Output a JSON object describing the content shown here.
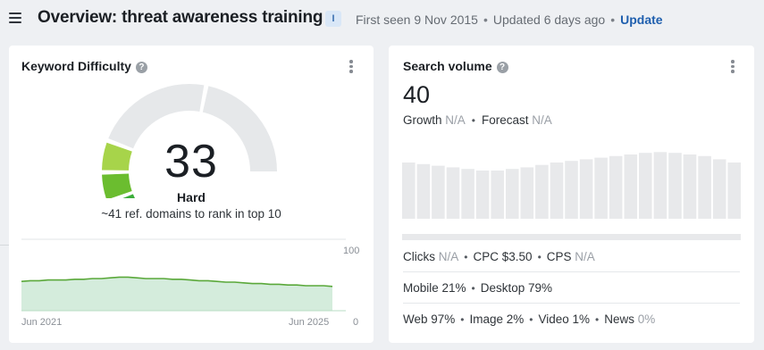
{
  "header": {
    "title": "Overview: threat awareness training",
    "info_badge": "I",
    "first_seen": "First seen 9 Nov 2015",
    "updated": "Updated 6 days ago",
    "update_link": "Update"
  },
  "keyword_difficulty": {
    "title": "Keyword Difficulty",
    "help_glyph": "?",
    "value": "33",
    "value_fraction": 0.33,
    "level": "Hard",
    "note": "~41 ref. domains to rank in top 10",
    "gauge_colors": [
      "#1fa353",
      "#3cae3b",
      "#6bbd2f",
      "#a7d44a",
      "#e6e8ea"
    ],
    "chart": {
      "type": "area",
      "y_tick_top": "100",
      "y_tick_bottom": "0",
      "x_start_label": "Jun 2021",
      "x_end_label": "Jun 2025",
      "ylim": [
        0,
        100
      ],
      "values": [
        41,
        42,
        42,
        43,
        43,
        43,
        44,
        44,
        45,
        45,
        46,
        47,
        47,
        46,
        45,
        45,
        45,
        44,
        44,
        43,
        42,
        42,
        41,
        40,
        40,
        39,
        38,
        38,
        37,
        37,
        36,
        36,
        35,
        35,
        35,
        34
      ],
      "line_color": "#5aa83a",
      "fill_color": "#d4ecdc"
    }
  },
  "search_volume": {
    "title": "Search volume",
    "help_glyph": "?",
    "value": "40",
    "growth_label": "Growth",
    "growth_value": "N/A",
    "forecast_label": "Forecast",
    "forecast_value": "N/A",
    "bar_color": "#e8e9eb",
    "bar_values": [
      0.7,
      0.68,
      0.66,
      0.64,
      0.62,
      0.6,
      0.6,
      0.62,
      0.64,
      0.67,
      0.7,
      0.72,
      0.74,
      0.76,
      0.78,
      0.8,
      0.82,
      0.83,
      0.82,
      0.8,
      0.78,
      0.74,
      0.7
    ],
    "clicks_label": "Clicks",
    "clicks_value": "N/A",
    "cpc_label": "CPC",
    "cpc_value": "$3.50",
    "cps_label": "CPS",
    "cps_value": "N/A",
    "mobile": "Mobile 21%",
    "desktop": "Desktop 79%",
    "web": "Web 97%",
    "image": "Image 2%",
    "video": "Video 1%",
    "news_label": "News",
    "news_value": "0%"
  }
}
